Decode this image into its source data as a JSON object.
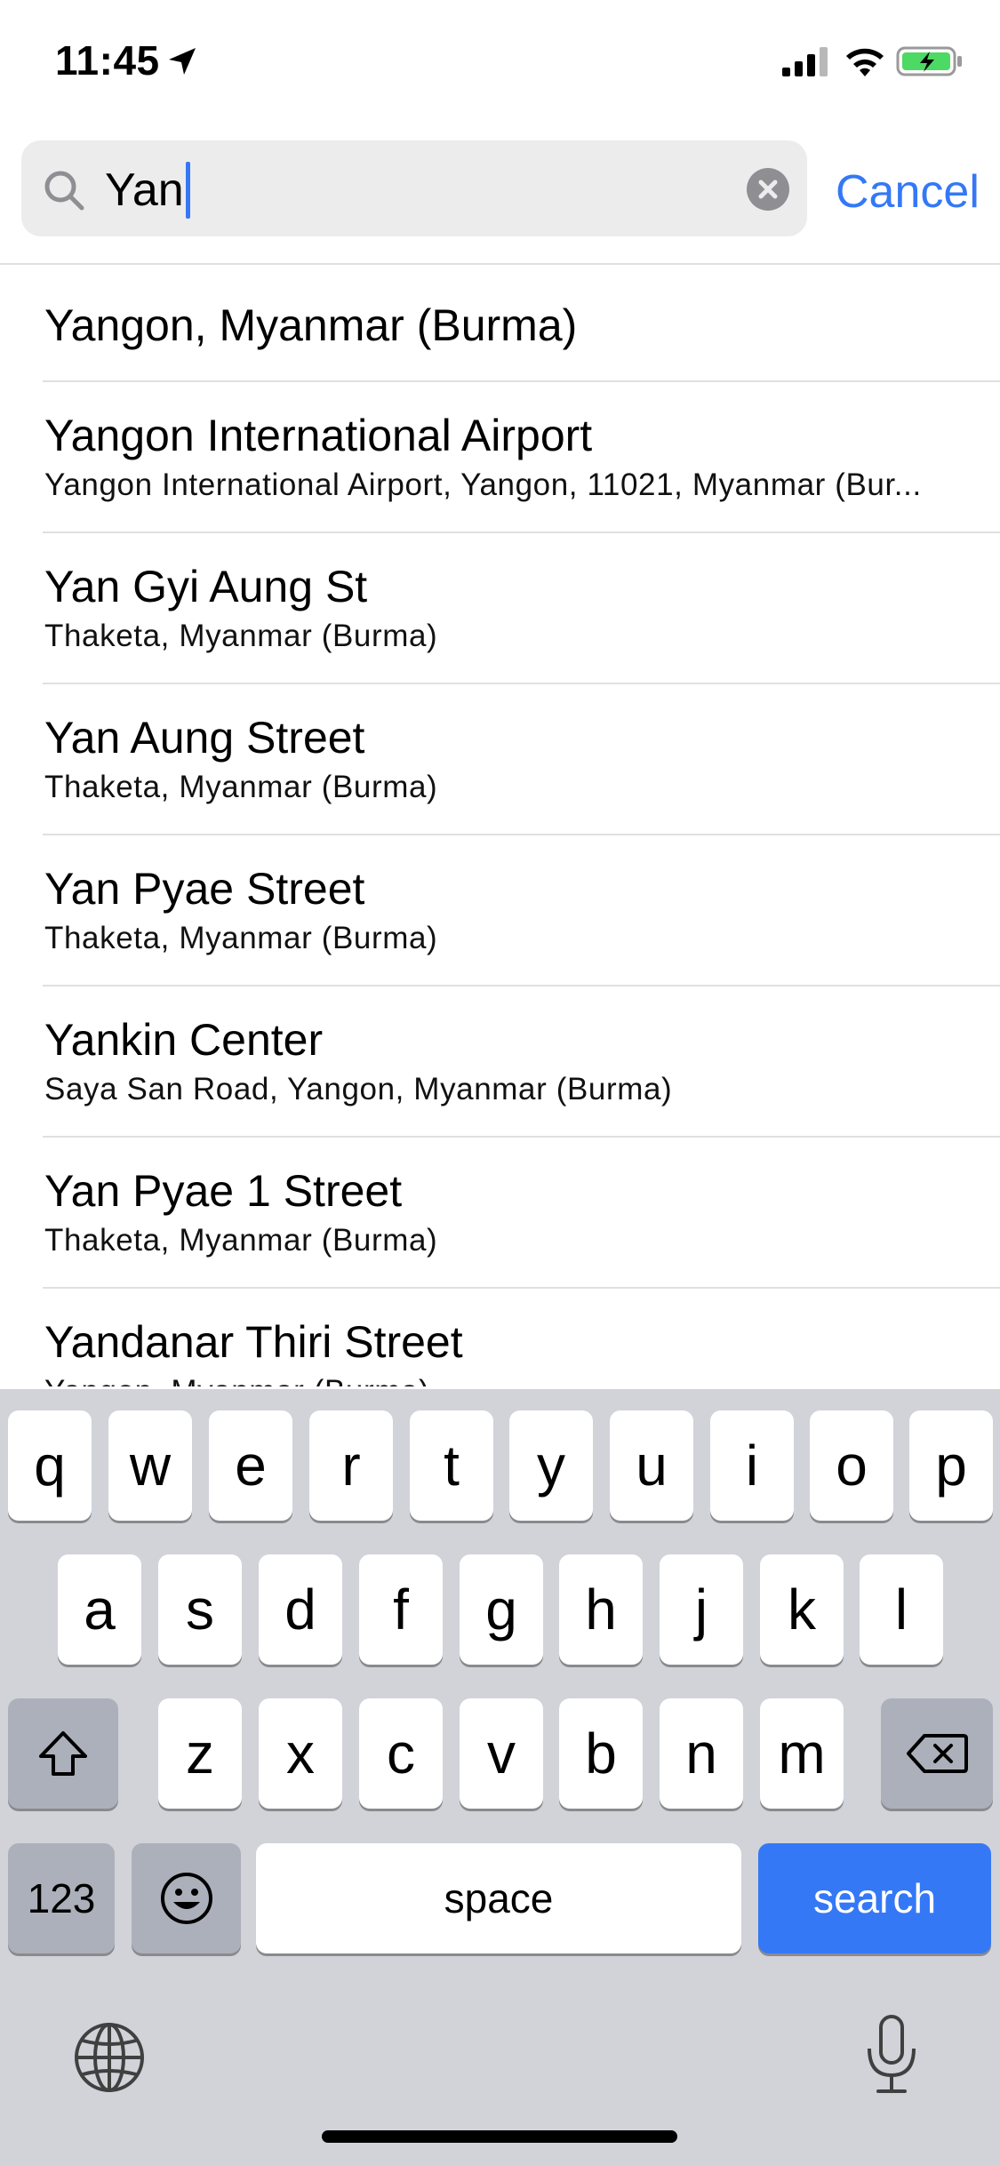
{
  "status_bar": {
    "time": "11:45",
    "icons": [
      "location-arrow-icon",
      "signal-icon",
      "wifi-icon",
      "battery-charging-icon"
    ]
  },
  "search": {
    "query": "Yan",
    "cancel_label": "Cancel",
    "accent_color": "#3478f6"
  },
  "results": [
    {
      "title": "Yangon, Myanmar (Burma)",
      "subtitle": ""
    },
    {
      "title": "Yangon International Airport",
      "subtitle": "Yangon International Airport, Yangon, 11021, Myanmar (Bur..."
    },
    {
      "title": "Yan Gyi Aung St",
      "subtitle": "Thaketa, Myanmar (Burma)"
    },
    {
      "title": "Yan Aung Street",
      "subtitle": "Thaketa, Myanmar (Burma)"
    },
    {
      "title": "Yan Pyae Street",
      "subtitle": "Thaketa, Myanmar (Burma)"
    },
    {
      "title": "Yankin Center",
      "subtitle": "Saya San Road, Yangon, Myanmar (Burma)"
    },
    {
      "title": "Yan Pyae 1 Street",
      "subtitle": "Thaketa, Myanmar (Burma)"
    },
    {
      "title": "Yandanar Thiri Street",
      "subtitle": "Yangon, Myanmar (Burma)"
    }
  ],
  "keyboard": {
    "row1": [
      "q",
      "w",
      "e",
      "r",
      "t",
      "y",
      "u",
      "i",
      "o",
      "p"
    ],
    "row2": [
      "a",
      "s",
      "d",
      "f",
      "g",
      "h",
      "j",
      "k",
      "l"
    ],
    "row3": [
      "z",
      "x",
      "c",
      "v",
      "b",
      "n",
      "m"
    ],
    "numbers_label": "123",
    "space_label": "space",
    "action_label": "search",
    "icons": [
      "shift-icon",
      "delete-icon",
      "emoji-icon",
      "globe-icon",
      "microphone-icon"
    ]
  }
}
